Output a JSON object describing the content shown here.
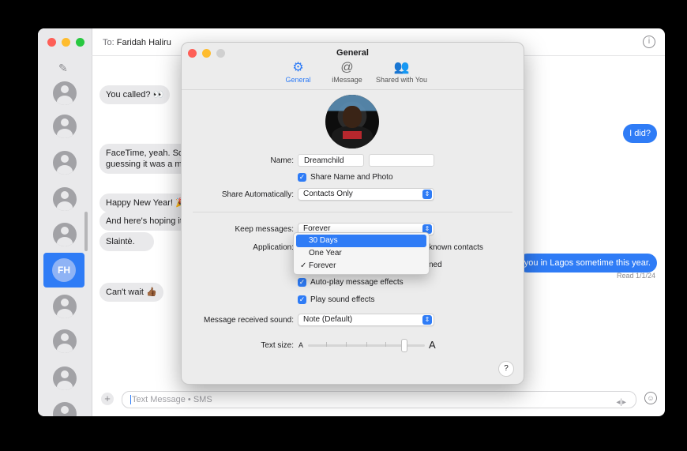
{
  "conversation": {
    "to_label": "To:",
    "to_name": "Faridah Haliru",
    "selected_initials": "FH"
  },
  "messages": [
    {
      "dir": "in",
      "text": "You called? 👀"
    },
    {
      "dir": "out",
      "text": "I did?"
    },
    {
      "dir": "in",
      "text": "FaceTime, yeah. Sor"
    },
    {
      "dir": "in",
      "text": "guessing it was a mi"
    },
    {
      "dir": "in",
      "text": "Happy New Year! 🎉"
    },
    {
      "dir": "in",
      "text": "And here's hoping it"
    },
    {
      "dir": "in",
      "text": "Slaintè."
    },
    {
      "dir": "out",
      "text": "you in Lagos sometime this year."
    },
    {
      "dir": "in",
      "text": "Can't wait 👍🏾"
    }
  ],
  "read_receipt": "Read 1/1/24",
  "input": {
    "placeholder": "Text Message • SMS"
  },
  "settings": {
    "title": "General",
    "tabs": [
      {
        "label": "General",
        "icon": "gear-icon",
        "glyph": "⚙"
      },
      {
        "label": "iMessage",
        "icon": "at-icon",
        "glyph": "@"
      },
      {
        "label": "Shared with You",
        "icon": "people-icon",
        "glyph": "👥"
      }
    ],
    "name_label": "Name:",
    "first_name": "Dreamchild",
    "last_name": "",
    "share_name_photo": "Share Name and Photo",
    "share_auto_label": "Share Automatically:",
    "share_auto_value": "Contacts Only",
    "keep_messages_label": "Keep messages:",
    "keep_messages_value": "Forever",
    "keep_options": [
      "30 Days",
      "One Year",
      "Forever"
    ],
    "application_label": "Application:",
    "partial_known": "known contacts",
    "partial_ned": "ned",
    "autoplay": "Auto-play message effects",
    "play_sounds": "Play sound effects",
    "sound_label": "Message received sound:",
    "sound_value": "Note (Default)",
    "text_size_label": "Text size:",
    "text_size_small": "A",
    "text_size_large": "A",
    "help": "?"
  },
  "colors": {
    "accent": "#2f7cf6",
    "bubble_in": "#e9e9eb"
  }
}
